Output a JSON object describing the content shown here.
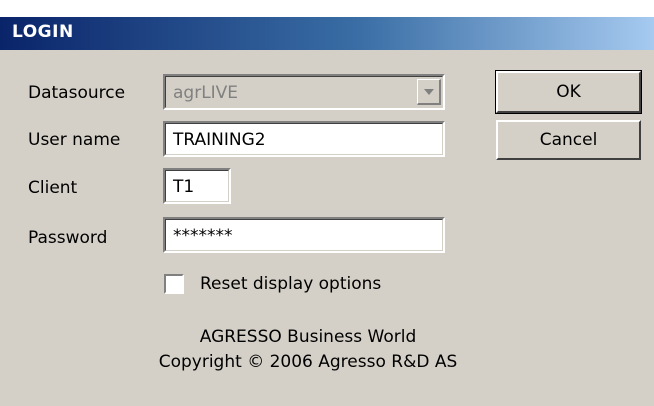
{
  "window": {
    "title": "LOGIN"
  },
  "form": {
    "datasource_label": "Datasource",
    "datasource_value": "agrLIVE",
    "username_label": "User name",
    "username_value": "TRAINING2",
    "client_label": "Client",
    "client_value": "T1",
    "password_label": "Password",
    "password_value": "*******",
    "reset_label": "Reset display options",
    "reset_checked": false
  },
  "buttons": {
    "ok": "OK",
    "cancel": "Cancel"
  },
  "footer": {
    "line1": "AGRESSO Business World",
    "line2": "Copyright © 2006 Agresso R&D AS"
  }
}
